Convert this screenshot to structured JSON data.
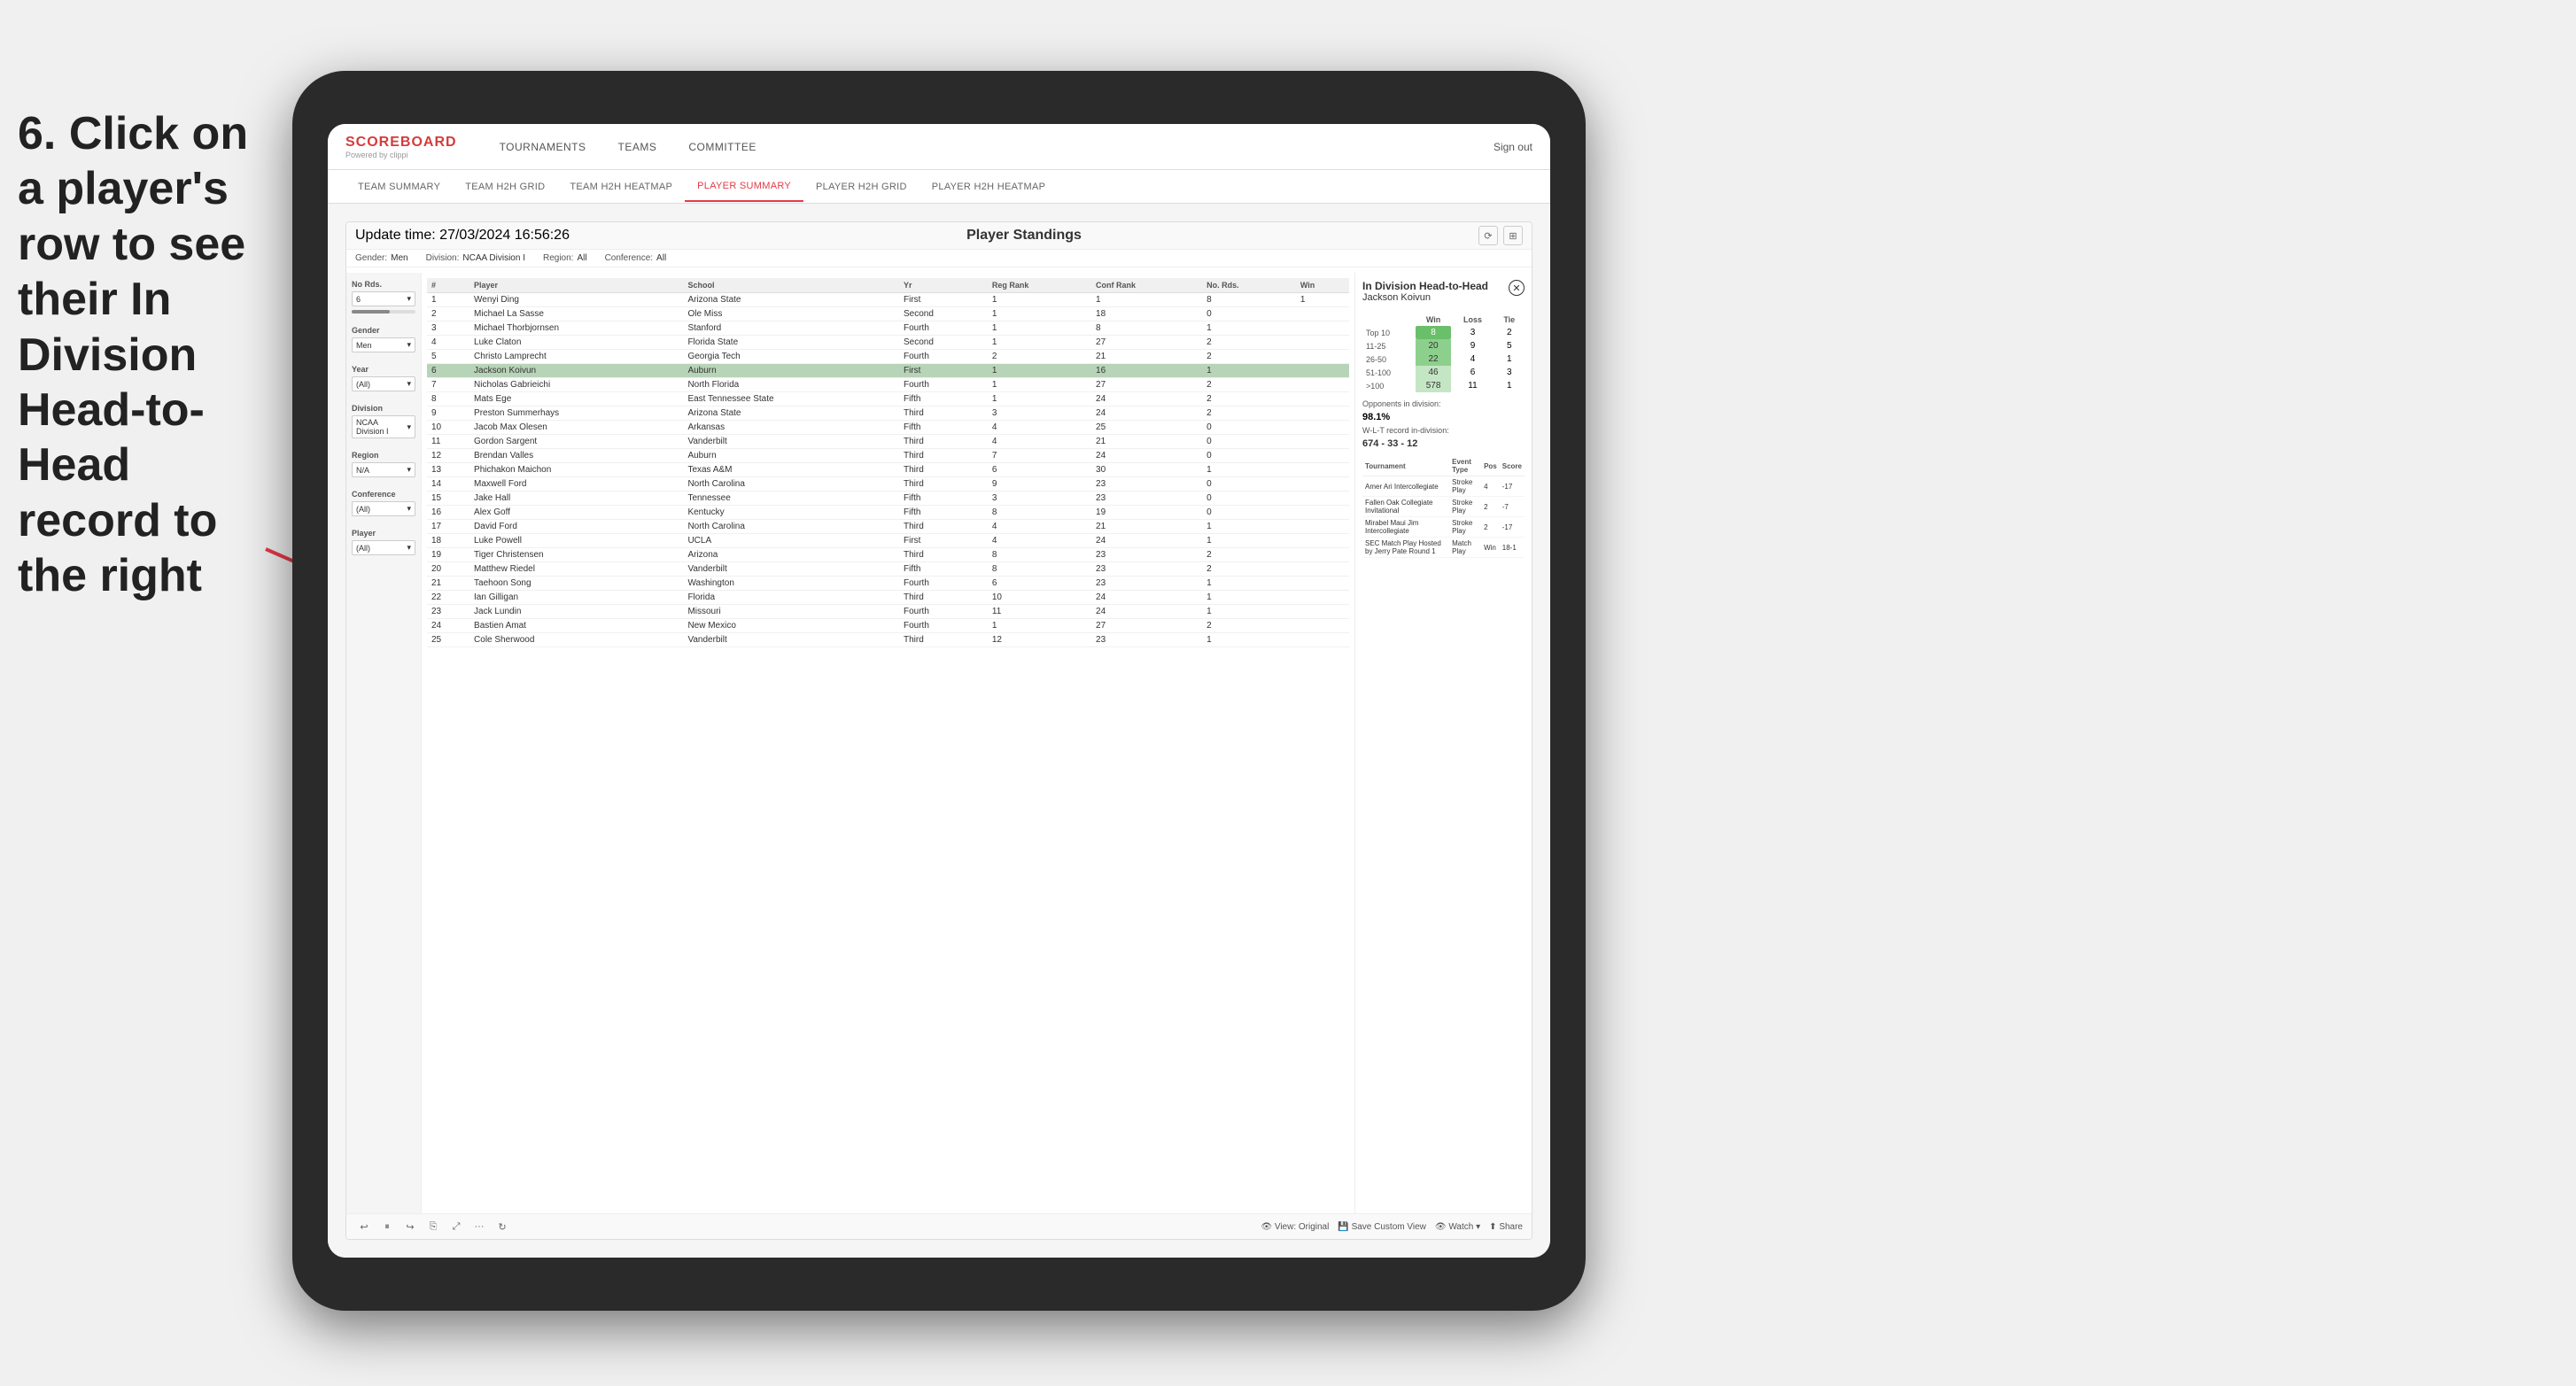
{
  "instruction": {
    "text": "6. Click on a player's row to see their In Division Head-to-Head record to the right"
  },
  "nav": {
    "logo": "SCOREBOARD",
    "logo_sub": "Powered by clippi",
    "items": [
      "TOURNAMENTS",
      "TEAMS",
      "COMMITTEE"
    ],
    "sign_out": "Sign out"
  },
  "sub_nav": {
    "items": [
      "TEAM SUMMARY",
      "TEAM H2H GRID",
      "TEAM H2H HEATMAP",
      "PLAYER SUMMARY",
      "PLAYER H2H GRID",
      "PLAYER H2H HEATMAP"
    ],
    "active": "PLAYER SUMMARY"
  },
  "panel": {
    "update_time_label": "Update time:",
    "update_time": "27/03/2024 16:56:26",
    "title": "Player Standings",
    "filters": {
      "gender_label": "Gender:",
      "gender": "Men",
      "division_label": "Division:",
      "division": "NCAA Division I",
      "region_label": "Region:",
      "region": "All",
      "conference_label": "Conference:",
      "conference": "All"
    }
  },
  "sidebar": {
    "no_rds_label": "No Rds.",
    "no_rds_value": "6",
    "gender_label": "Gender",
    "gender_value": "Men",
    "year_label": "Year",
    "year_value": "(All)",
    "division_label": "Division",
    "division_value": "NCAA Division I",
    "region_label": "Region",
    "region_value": "N/A",
    "conference_label": "Conference",
    "conference_value": "(All)",
    "player_label": "Player",
    "player_value": "(All)"
  },
  "table": {
    "headers": [
      "#",
      "Player",
      "School",
      "Yr",
      "Reg Rank",
      "Conf Rank",
      "No. Rds.",
      "Win"
    ],
    "rows": [
      {
        "num": "1",
        "player": "Wenyi Ding",
        "school": "Arizona State",
        "yr": "First",
        "reg": "1",
        "conf": "1",
        "rds": "8",
        "win": "1"
      },
      {
        "num": "2",
        "player": "Michael La Sasse",
        "school": "Ole Miss",
        "yr": "Second",
        "reg": "1",
        "conf": "18",
        "rds": "0"
      },
      {
        "num": "3",
        "player": "Michael Thorbjornsen",
        "school": "Stanford",
        "yr": "Fourth",
        "reg": "1",
        "conf": "8",
        "rds": "1"
      },
      {
        "num": "4",
        "player": "Luke Claton",
        "school": "Florida State",
        "yr": "Second",
        "reg": "1",
        "conf": "27",
        "rds": "2"
      },
      {
        "num": "5",
        "player": "Christo Lamprecht",
        "school": "Georgia Tech",
        "yr": "Fourth",
        "reg": "2",
        "conf": "21",
        "rds": "2"
      },
      {
        "num": "6",
        "player": "Jackson Koivun",
        "school": "Auburn",
        "yr": "First",
        "reg": "1",
        "conf": "16",
        "rds": "1",
        "highlighted": true
      },
      {
        "num": "7",
        "player": "Nicholas Gabrieichi",
        "school": "North Florida",
        "yr": "Fourth",
        "reg": "1",
        "conf": "27",
        "rds": "2"
      },
      {
        "num": "8",
        "player": "Mats Ege",
        "school": "East Tennessee State",
        "yr": "Fifth",
        "reg": "1",
        "conf": "24",
        "rds": "2"
      },
      {
        "num": "9",
        "player": "Preston Summerhays",
        "school": "Arizona State",
        "yr": "Third",
        "reg": "3",
        "conf": "24",
        "rds": "2"
      },
      {
        "num": "10",
        "player": "Jacob Max Olesen",
        "school": "Arkansas",
        "yr": "Fifth",
        "reg": "4",
        "conf": "25",
        "rds": "0"
      },
      {
        "num": "11",
        "player": "Gordon Sargent",
        "school": "Vanderbilt",
        "yr": "Third",
        "reg": "4",
        "conf": "21",
        "rds": "0"
      },
      {
        "num": "12",
        "player": "Brendan Valles",
        "school": "Auburn",
        "yr": "Third",
        "reg": "7",
        "conf": "24",
        "rds": "0"
      },
      {
        "num": "13",
        "player": "Phichakon Maichon",
        "school": "Texas A&M",
        "yr": "Third",
        "reg": "6",
        "conf": "30",
        "rds": "1"
      },
      {
        "num": "14",
        "player": "Maxwell Ford",
        "school": "North Carolina",
        "yr": "Third",
        "reg": "9",
        "conf": "23",
        "rds": "0"
      },
      {
        "num": "15",
        "player": "Jake Hall",
        "school": "Tennessee",
        "yr": "Fifth",
        "reg": "3",
        "conf": "23",
        "rds": "0"
      },
      {
        "num": "16",
        "player": "Alex Goff",
        "school": "Kentucky",
        "yr": "Fifth",
        "reg": "8",
        "conf": "19",
        "rds": "0"
      },
      {
        "num": "17",
        "player": "David Ford",
        "school": "North Carolina",
        "yr": "Third",
        "reg": "4",
        "conf": "21",
        "rds": "1"
      },
      {
        "num": "18",
        "player": "Luke Powell",
        "school": "UCLA",
        "yr": "First",
        "reg": "4",
        "conf": "24",
        "rds": "1"
      },
      {
        "num": "19",
        "player": "Tiger Christensen",
        "school": "Arizona",
        "yr": "Third",
        "reg": "8",
        "conf": "23",
        "rds": "2"
      },
      {
        "num": "20",
        "player": "Matthew Riedel",
        "school": "Vanderbilt",
        "yr": "Fifth",
        "reg": "8",
        "conf": "23",
        "rds": "2"
      },
      {
        "num": "21",
        "player": "Taehoon Song",
        "school": "Washington",
        "yr": "Fourth",
        "reg": "6",
        "conf": "23",
        "rds": "1"
      },
      {
        "num": "22",
        "player": "Ian Gilligan",
        "school": "Florida",
        "yr": "Third",
        "reg": "10",
        "conf": "24",
        "rds": "1"
      },
      {
        "num": "23",
        "player": "Jack Lundin",
        "school": "Missouri",
        "yr": "Fourth",
        "reg": "11",
        "conf": "24",
        "rds": "1"
      },
      {
        "num": "24",
        "player": "Bastien Amat",
        "school": "New Mexico",
        "yr": "Fourth",
        "reg": "1",
        "conf": "27",
        "rds": "2"
      },
      {
        "num": "25",
        "player": "Cole Sherwood",
        "school": "Vanderbilt",
        "yr": "Third",
        "reg": "12",
        "conf": "23",
        "rds": "1"
      }
    ]
  },
  "h2h": {
    "title": "In Division Head-to-Head",
    "player_name": "Jackson Koivun",
    "table_headers": [
      "",
      "Win",
      "Loss",
      "Tie"
    ],
    "rows": [
      {
        "rank": "Top 10",
        "win": "8",
        "loss": "3",
        "tie": "2",
        "win_class": "cell-green"
      },
      {
        "rank": "11-25",
        "win": "20",
        "loss": "9",
        "tie": "5",
        "win_class": "cell-light-green"
      },
      {
        "rank": "26-50",
        "win": "22",
        "loss": "4",
        "tie": "1",
        "win_class": "cell-light-green"
      },
      {
        "rank": "51-100",
        "win": "46",
        "loss": "6",
        "tie": "3",
        "win_class": "cell-pale-green"
      },
      {
        "rank": ">100",
        "win": "578",
        "loss": "11",
        "tie": "1",
        "win_class": "cell-pale-green"
      }
    ],
    "opponents_label": "Opponents in division:",
    "opponents_pct": "98.1%",
    "record_label": "W-L-T record in-division:",
    "record": "674 - 33 - 12",
    "tournaments": {
      "headers": [
        "Tournament",
        "Event Type",
        "Pos",
        "Score"
      ],
      "rows": [
        {
          "tournament": "Amer Ari Intercollegiate",
          "type": "Stroke Play",
          "pos": "4",
          "score": "-17"
        },
        {
          "tournament": "Fallen Oak Collegiate Invitational",
          "type": "Stroke Play",
          "pos": "2",
          "score": "-7"
        },
        {
          "tournament": "Mirabel Maui Jim Intercollegiate",
          "type": "Stroke Play",
          "pos": "2",
          "score": "-17"
        },
        {
          "tournament": "SEC Match Play Hosted by Jerry Pate Round 1",
          "type": "Match Play",
          "pos": "Win",
          "score": "18-1"
        }
      ]
    }
  },
  "bottom_toolbar": {
    "view_original": "View: Original",
    "save_custom_view": "Save Custom View",
    "watch": "Watch",
    "share": "Share"
  }
}
